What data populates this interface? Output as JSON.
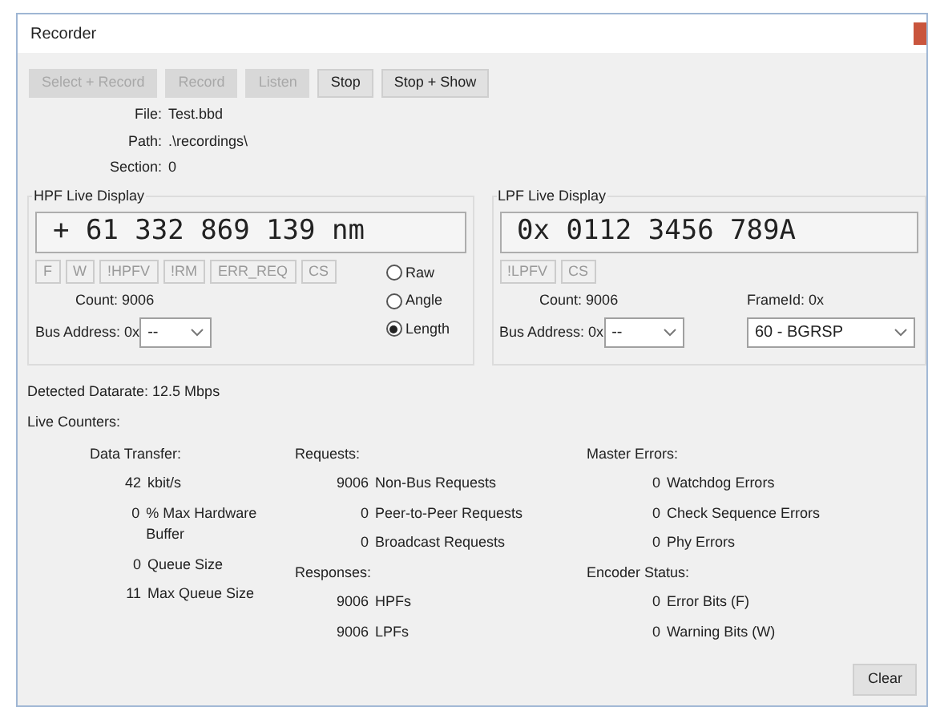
{
  "window": {
    "title": "Recorder"
  },
  "toolbar": [
    {
      "label": "Select + Record",
      "disabled": true
    },
    {
      "label": "Record",
      "disabled": true
    },
    {
      "label": "Listen",
      "disabled": true
    },
    {
      "label": "Stop",
      "disabled": false
    },
    {
      "label": "Stop + Show",
      "disabled": false
    }
  ],
  "info": [
    {
      "label": "File:",
      "value": "Test.bbd"
    },
    {
      "label": "Path:",
      "value": ".\\recordings\\"
    },
    {
      "label": "Section:",
      "value": "0"
    }
  ],
  "hpf": {
    "title": "HPF Live Display",
    "display": "+ 61 332 869 139 nm",
    "flags": [
      "F",
      "W",
      "!HPFV",
      "!RM",
      "ERR_REQ",
      "CS"
    ],
    "count_label": "Count:",
    "count": "9006",
    "bus_label": "Bus Address:",
    "bus_prefix": "0x",
    "bus_value": "--",
    "modes": [
      {
        "label": "Raw",
        "selected": false
      },
      {
        "label": "Angle",
        "selected": false
      },
      {
        "label": "Length",
        "selected": true
      }
    ]
  },
  "lpf": {
    "title": "LPF Live Display",
    "display": "0x 0112 3456 789A",
    "flags": [
      "!LPFV",
      "CS"
    ],
    "count_label": "Count:",
    "count": "9006",
    "bus_label": "Bus Address:",
    "bus_prefix": "0x",
    "bus_value": "--",
    "frame_label": "FrameId: 0x",
    "frame_value": "60 - BGRSP"
  },
  "datarate": "Detected Datarate: 12.5 Mbps",
  "live_counters": "Live Counters:",
  "counter_columns": [
    [
      {
        "heading": "Data Transfer:",
        "items": [
          {
            "value": "42",
            "label": "kbit/s"
          },
          {
            "value": "0",
            "label": "% Max Hardware Buffer"
          },
          {
            "value": "0",
            "label": "Queue Size"
          },
          {
            "value": "11",
            "label": "Max Queue Size"
          }
        ]
      }
    ],
    [
      {
        "heading": "Requests:",
        "items": [
          {
            "value": "9006",
            "label": "Non-Bus Requests"
          },
          {
            "value": "0",
            "label": "Peer-to-Peer Requests"
          },
          {
            "value": "0",
            "label": "Broadcast Requests"
          }
        ]
      },
      {
        "heading": "Responses:",
        "items": [
          {
            "value": "9006",
            "label": "HPFs"
          },
          {
            "value": "9006",
            "label": "LPFs"
          }
        ]
      }
    ],
    [
      {
        "heading": "Master Errors:",
        "items": [
          {
            "value": "0",
            "label": "Watchdog Errors"
          },
          {
            "value": "0",
            "label": "Check Sequence Errors"
          },
          {
            "value": "0",
            "label": "Phy Errors"
          }
        ]
      },
      {
        "heading": "Encoder Status:",
        "items": [
          {
            "value": "0",
            "label": "Error Bits (F)"
          },
          {
            "value": "0",
            "label": "Warning Bits (W)"
          }
        ]
      }
    ]
  ],
  "clear_button": "Clear"
}
